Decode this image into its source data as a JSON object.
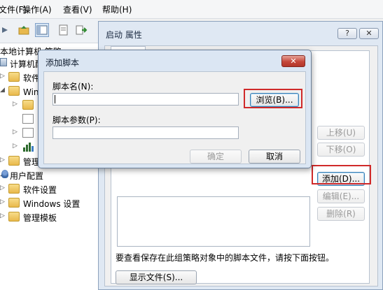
{
  "menubar": {
    "items": [
      "文件(F)",
      "操作(A)",
      "查看(V)",
      "帮助(H)"
    ]
  },
  "tree": {
    "items": [
      {
        "label": "本地计算机 策略"
      },
      {
        "label": "计算机配置"
      },
      {
        "label": "软件设置"
      },
      {
        "label": "Windows 设置"
      },
      {
        "label": ""
      },
      {
        "label": ""
      },
      {
        "label": ""
      },
      {
        "label": ""
      },
      {
        "label": "管理模板"
      },
      {
        "label": "用户配置"
      },
      {
        "label": "软件设置"
      },
      {
        "label": "Windows 设置"
      },
      {
        "label": "管理模板"
      }
    ]
  },
  "props_dialog": {
    "title": "启动 属性",
    "help_label": "?",
    "close_label": "✕",
    "buttons": {
      "up": "上移(U)",
      "down": "下移(O)",
      "add": "添加(D)...",
      "edit": "编辑(E)...",
      "remove": "删除(R)"
    },
    "hint": "要查看保存在此组策略对象中的脚本文件，请按下面按钮。",
    "show_files": "显示文件(S)..."
  },
  "add_dialog": {
    "title": "添加脚本",
    "close_label": "✕",
    "script_name_label": "脚本名(N):",
    "script_name_value": "",
    "browse": "浏览(B)...",
    "script_params_label": "脚本参数(P):",
    "script_params_value": "",
    "ok": "确定",
    "cancel": "取消"
  },
  "colors": {
    "highlight": "#d02a2a",
    "title_bar": "#dbe6f3"
  }
}
